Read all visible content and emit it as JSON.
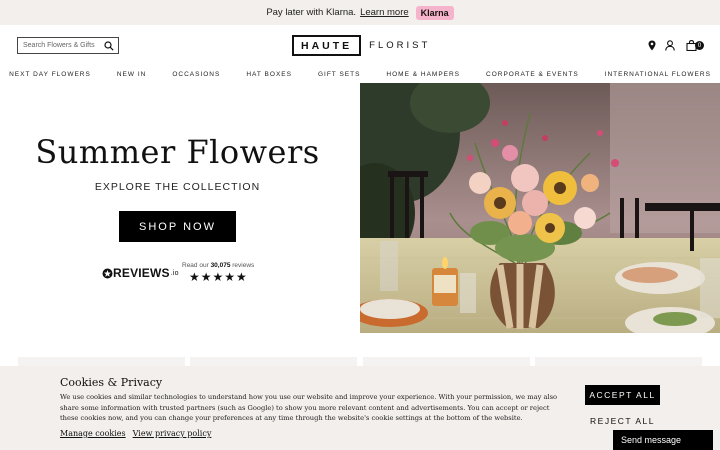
{
  "promo": {
    "text": "Pay later with Klarna.",
    "link": "Learn more",
    "badge": "Klarna"
  },
  "header": {
    "search_placeholder": "Search Flowers & Gifts",
    "logo_boxed": "HAUTE",
    "logo_rest": "FLORIST",
    "cart_count": "0"
  },
  "nav": {
    "items": [
      "NEXT DAY FLOWERS",
      "NEW IN",
      "OCCASIONS",
      "HAT BOXES",
      "GIFT SETS",
      "HOME & HAMPERS",
      "CORPORATE & EVENTS",
      "INTERNATIONAL FLOWERS"
    ]
  },
  "hero": {
    "title": "Summer Flowers",
    "subtitle": "EXPLORE THE COLLECTION",
    "button": "SHOP NOW"
  },
  "reviews": {
    "brand": "REVIEWS",
    "brand_suffix": ".io",
    "count_prefix": "Read our",
    "count": "30,075",
    "count_suffix": "reviews",
    "stars": "★★★★★",
    "rating": 4.5
  },
  "cookie": {
    "title": "Cookies & Privacy",
    "body": "We use cookies and similar technologies to understand how you use our website and improve your experience. With your permission, we may also share some information with trusted partners (such as Google) to show you more relevant content and advertisements. You can accept or reject these cookies now, and you can change your preferences at any time through the website's cookie settings at the bottom of the website.",
    "manage": "Manage cookies",
    "privacy": "View privacy policy",
    "accept": "ACCEPT ALL",
    "reject": "REJECT ALL"
  },
  "chat": {
    "label": "Send message"
  },
  "colors": {
    "promo_bg": "#f2efec",
    "klarna_pink": "#f5b3cc",
    "primary": "#000000",
    "cookie_bg": "#f2efec"
  }
}
